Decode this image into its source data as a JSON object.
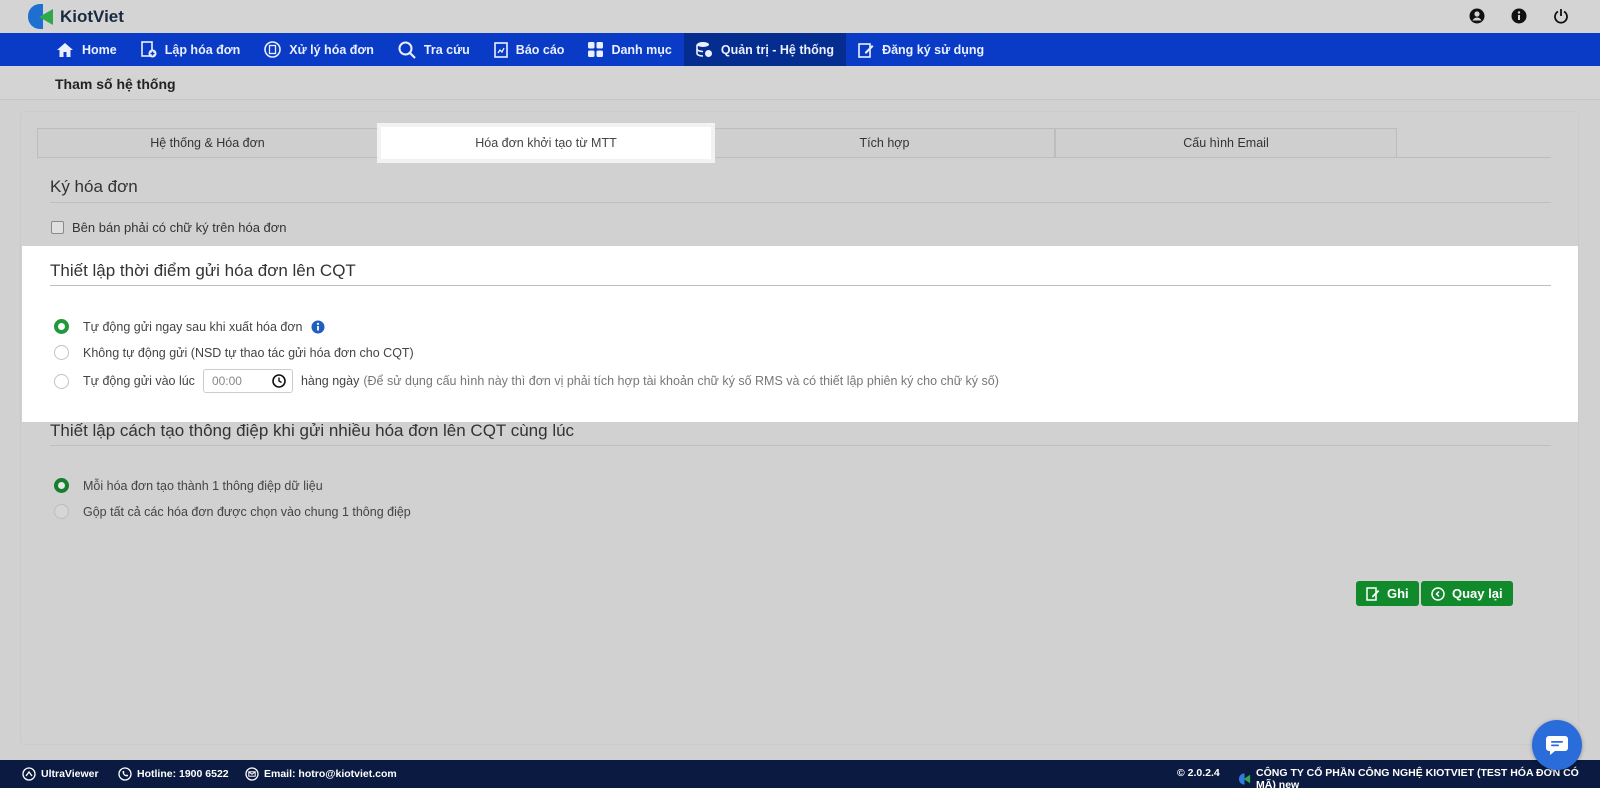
{
  "app": {
    "name": "KiotViet"
  },
  "nav": [
    {
      "label": "Home",
      "icon": "home-icon"
    },
    {
      "label": "Lập hóa đơn",
      "icon": "invoice-add-icon"
    },
    {
      "label": "Xử lý hóa đơn",
      "icon": "invoice-process-icon"
    },
    {
      "label": "Tra cứu",
      "icon": "search-icon"
    },
    {
      "label": "Báo cáo",
      "icon": "report-icon"
    },
    {
      "label": "Danh mục",
      "icon": "grid-icon"
    },
    {
      "label": "Quản trị - Hệ thống",
      "icon": "database-icon",
      "active": true
    },
    {
      "label": "Đăng ký sử dụng",
      "icon": "edit-icon"
    }
  ],
  "page": {
    "title": "Tham số hệ thống"
  },
  "tabs": [
    {
      "label": "Hệ thống & Hóa đơn"
    },
    {
      "label": "Hóa đơn khởi tạo từ MTT",
      "active": true
    },
    {
      "label": "Tích hợp"
    },
    {
      "label": "Cấu hình Email"
    }
  ],
  "sign_section": {
    "title": "Ký hóa đơn",
    "checkbox_label": "Bên bán phải có chữ ký trên hóa đơn"
  },
  "send_section": {
    "title": "Thiết lập thời điểm gửi hóa đơn lên CQT",
    "opt_auto": "Tự động gửi ngay sau khi xuất hóa đơn",
    "opt_manual": "Không tự động gửi (NSD tự thao tác gửi hóa đơn cho CQT)",
    "opt_scheduled": "Tự động gửi vào lúc",
    "time_placeholder": "00:00",
    "daily": "hàng ngày",
    "hint": "(Để sử dụng cấu hình này thì đơn vị phải tích hợp tài khoản chữ ký số RMS và có thiết lập phiên ký cho chữ ký số)"
  },
  "message_section": {
    "title": "Thiết lập cách tạo thông điệp khi gửi nhiều hóa đơn lên CQT cùng lúc",
    "opt_each": "Mỗi hóa đơn tạo thành 1 thông điệp dữ liệu",
    "opt_merge": "Gộp tất cả các hóa đơn được chọn vào chung 1 thông điệp"
  },
  "buttons": {
    "save": "Ghi",
    "back": "Quay lại"
  },
  "footer": {
    "ultraviewer": "UltraViewer",
    "hotline": "Hotline: 1900 6522",
    "email": "Email: hotro@kiotviet.com",
    "version": "© 2.0.2.4",
    "company": "CÔNG TY CỔ PHẦN CÔNG NGHỆ KIOTVIET (TEST HÓA ĐƠN CÓ MÃ) new"
  },
  "colors": {
    "nav_bg": "#0a3bc7",
    "nav_active": "#052c8f",
    "accent_green": "#118a2c",
    "footer_bg": "#0a1a40"
  }
}
